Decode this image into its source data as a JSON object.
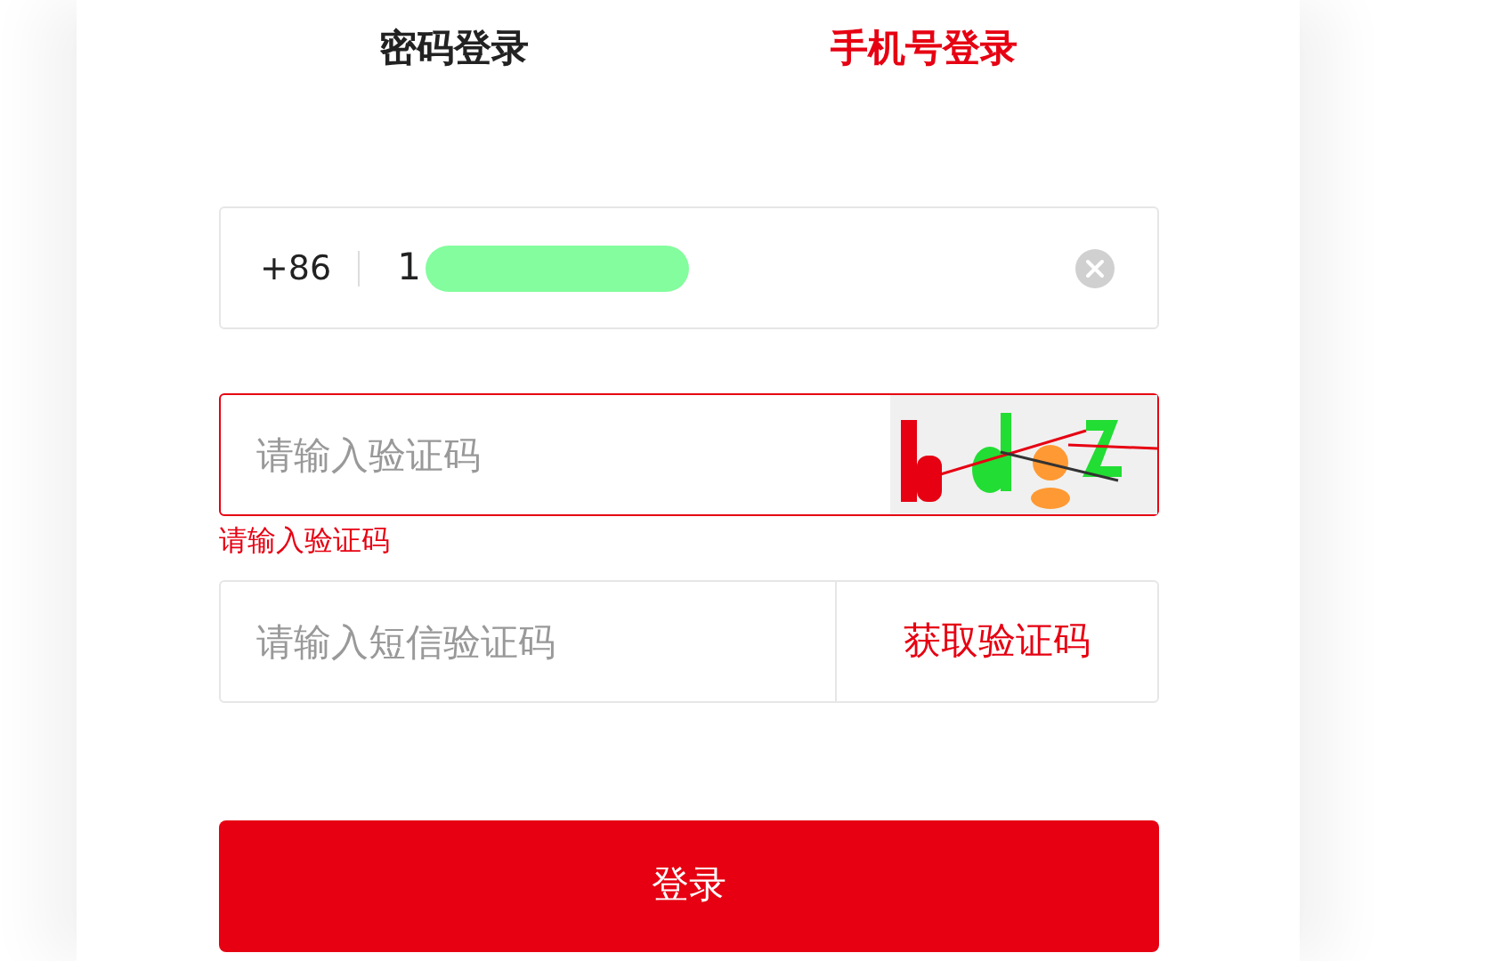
{
  "tabs": [
    {
      "label": "密码登录",
      "selected": false
    },
    {
      "label": "手机号登录",
      "selected": true
    }
  ],
  "phone": {
    "country_code": "+86",
    "value": "1",
    "redacted": true,
    "clearable": true
  },
  "captcha": {
    "placeholder": "请输入验证码",
    "error": true,
    "error_message": "请输入验证码"
  },
  "sms": {
    "placeholder": "请输入短信验证码",
    "button": "获取验证码"
  },
  "login_button": "登录"
}
